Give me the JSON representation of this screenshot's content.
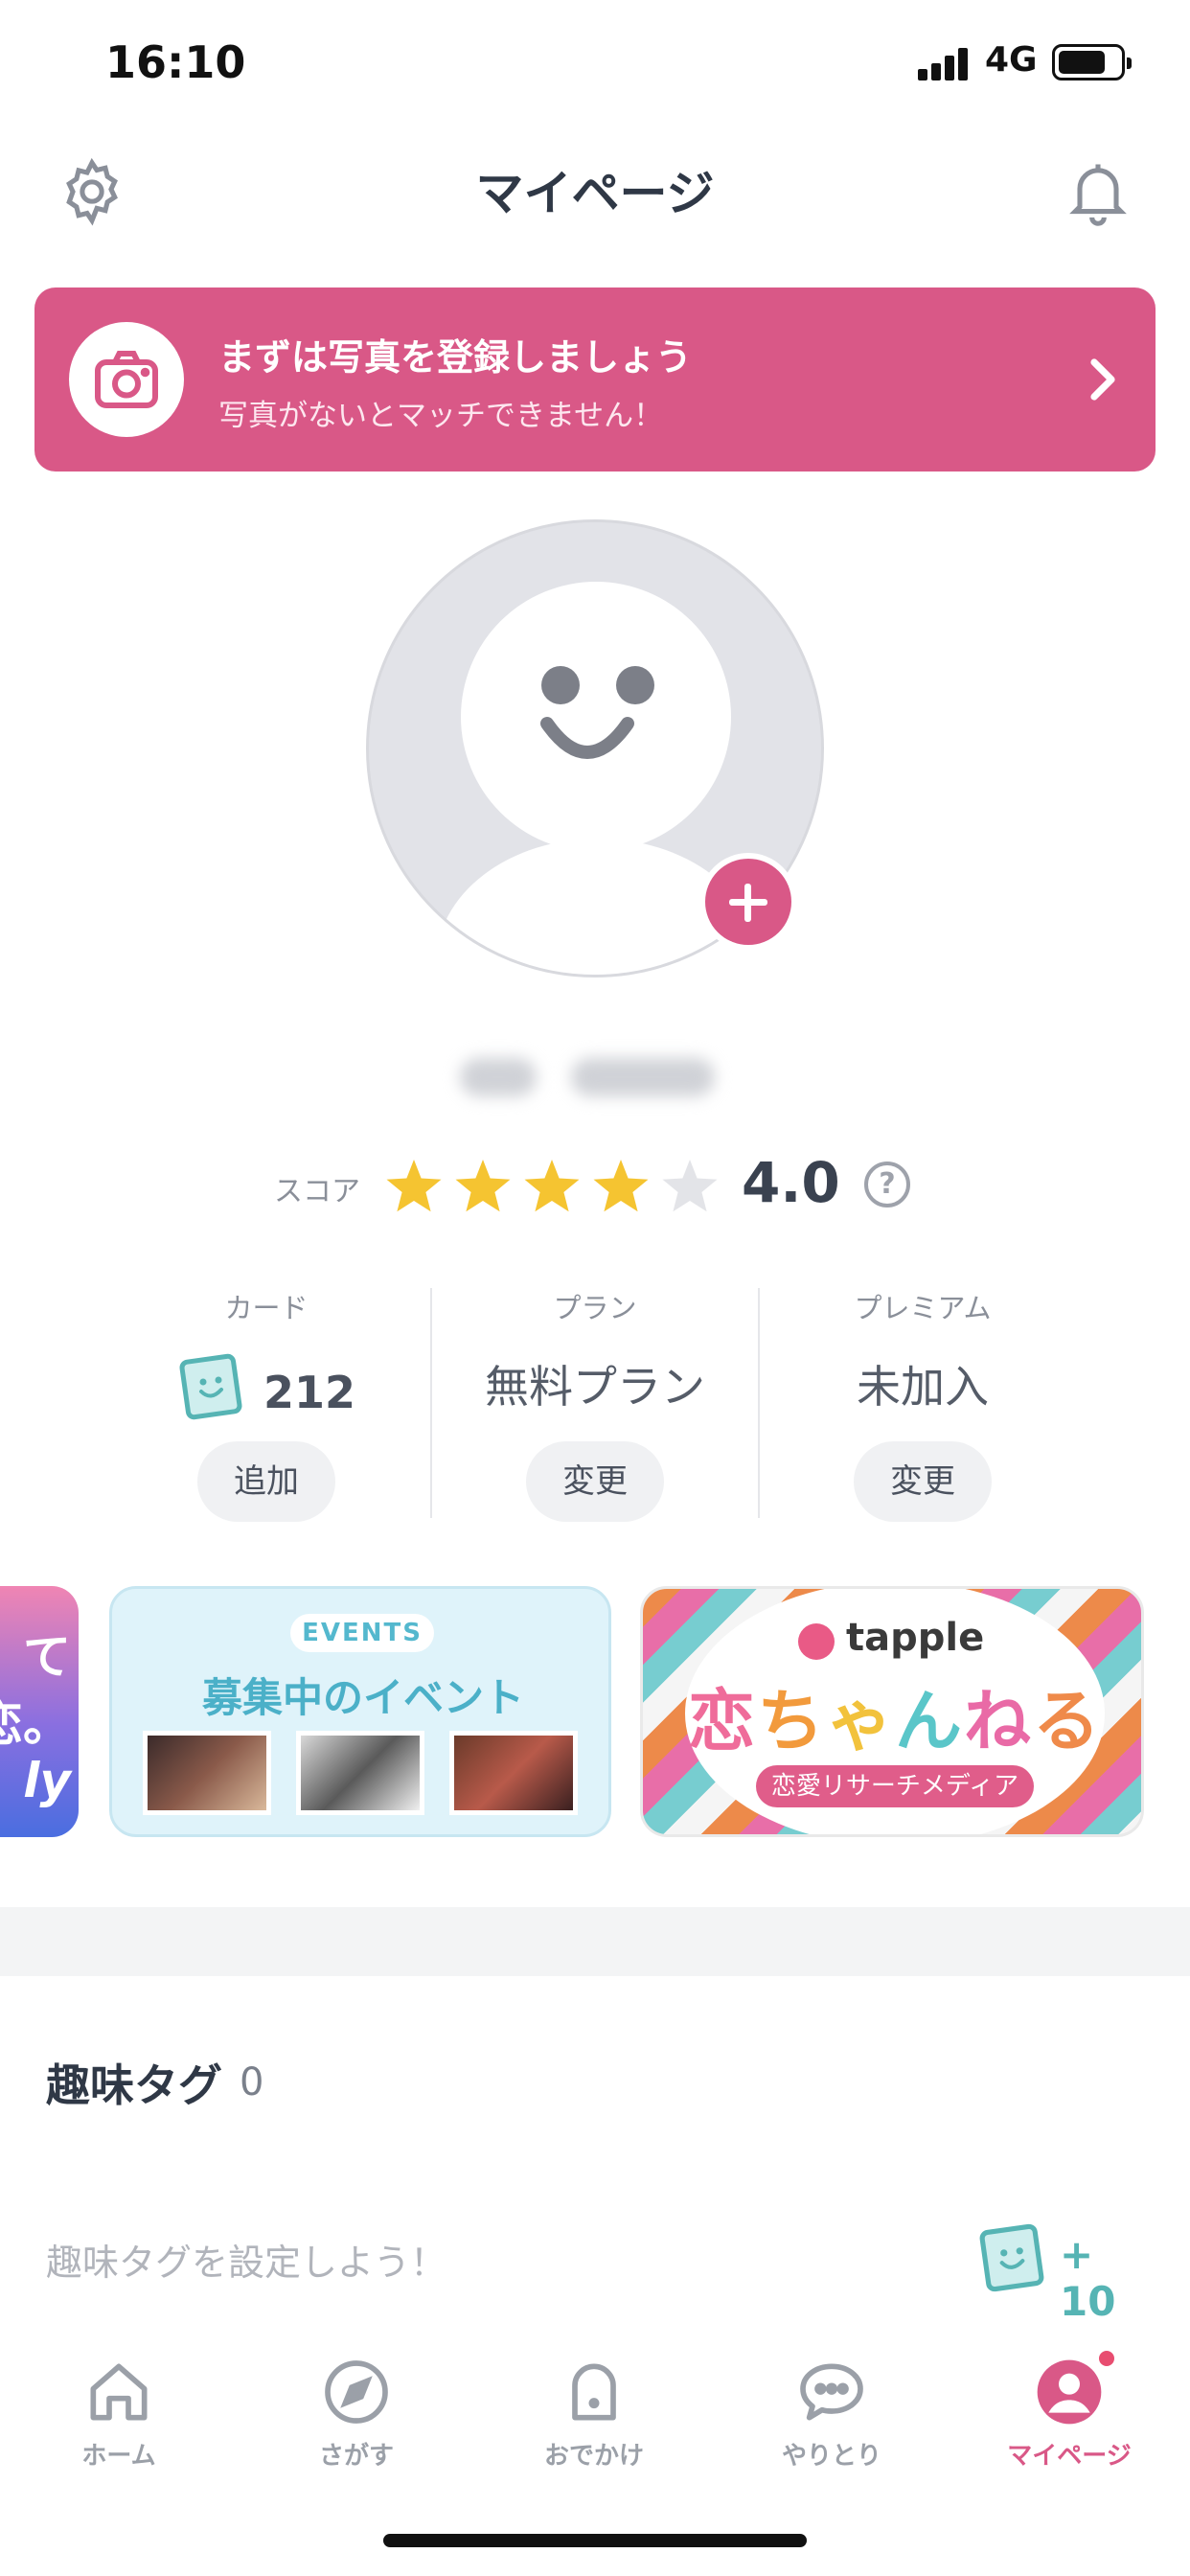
{
  "status_bar": {
    "time": "16:10",
    "network": "4G"
  },
  "header": {
    "title": "マイページ"
  },
  "photo_banner": {
    "title": "まずは写真を登録しましょう",
    "subtitle": "写真がないとマッチできません！"
  },
  "score": {
    "label": "スコア",
    "value": "4.0",
    "stars_filled": 4,
    "stars_total": 5,
    "help_symbol": "?"
  },
  "stats": {
    "card": {
      "header": "カード",
      "value": "212",
      "button": "追加"
    },
    "plan": {
      "header": "プラン",
      "value": "無料プラン",
      "button": "変更"
    },
    "premium": {
      "header": "プレミアム",
      "value": "未加入",
      "button": "変更"
    }
  },
  "promos": {
    "left_partial_lines": [
      "て",
      "恋。",
      "ly"
    ],
    "events": {
      "pill": "EVENTS",
      "title": "募集中のイベント"
    },
    "tapple": {
      "brand": "tapple",
      "title_chars": [
        "恋",
        "ち",
        "ゃ",
        "ん",
        "ね",
        "る"
      ],
      "tag": "恋愛リサーチメディア"
    }
  },
  "hobby": {
    "title": "趣味タグ",
    "count": "0",
    "hint": "趣味タグを設定しよう！",
    "reward": "+ 10"
  },
  "tabbar": {
    "items": [
      {
        "label": "ホーム",
        "icon": "home-icon"
      },
      {
        "label": "さがす",
        "icon": "compass-icon"
      },
      {
        "label": "おでかけ",
        "icon": "ghost-icon"
      },
      {
        "label": "やりとり",
        "icon": "chat-bubble-icon"
      },
      {
        "label": "マイページ",
        "icon": "profile-icon"
      }
    ],
    "active_index": 4
  },
  "colors": {
    "accent": "#d95887",
    "teal": "#56b4b4",
    "star": "#f5c431"
  }
}
